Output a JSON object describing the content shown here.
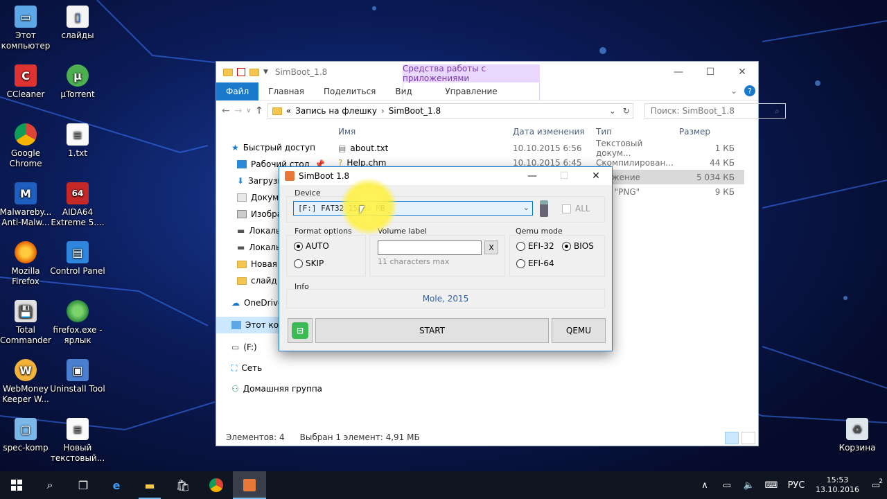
{
  "desktop": {
    "icons": [
      {
        "label": "Этот компьютер",
        "icon": "computer-icon"
      },
      {
        "label": "слайды",
        "icon": "file-icon"
      },
      {
        "label": "CCleaner",
        "icon": "ccleaner-icon"
      },
      {
        "label": "µTorrent",
        "icon": "utorrent-icon"
      },
      {
        "label": "Google Chrome",
        "icon": "chrome-icon"
      },
      {
        "label": "1.txt",
        "icon": "text-file-icon"
      },
      {
        "label": "Malwareby... Anti-Malw...",
        "icon": "malwarebytes-icon"
      },
      {
        "label": "AIDA64 Extreme 5....",
        "icon": "aida64-icon"
      },
      {
        "label": "Mozilla Firefox",
        "icon": "firefox-icon"
      },
      {
        "label": "Control Panel",
        "icon": "control-panel-icon"
      },
      {
        "label": "Total Commander",
        "icon": "total-commander-icon"
      },
      {
        "label": "firefox.exe - ярлык",
        "icon": "firefox-shortcut-icon"
      },
      {
        "label": "WebMoney Keeper W...",
        "icon": "webmoney-icon"
      },
      {
        "label": "Uninstall Tool",
        "icon": "uninstall-tool-icon"
      },
      {
        "label": "spec-komp",
        "icon": "spec-komp-icon"
      },
      {
        "label": "Новый текстовый...",
        "icon": "text-file-icon"
      },
      {
        "label": "Корзина",
        "icon": "recycle-bin-icon"
      }
    ]
  },
  "explorer": {
    "title": "SimBoot_1.8",
    "context_tab": "Средства работы с приложениями",
    "ribbon": {
      "file": "Файл",
      "home": "Главная",
      "share": "Поделиться",
      "view": "Вид",
      "manage": "Управление"
    },
    "address": {
      "prefix": "«",
      "parent": "Запись на флешку",
      "current": "SimBoot_1.8"
    },
    "search_placeholder": "Поиск: SimBoot_1.8",
    "nav": [
      {
        "label": "Быстрый доступ",
        "icon": "star-icon"
      },
      {
        "label": "Рабочий стол",
        "icon": "desktop-icon"
      },
      {
        "label": "Загрузк",
        "icon": "download-icon"
      },
      {
        "label": "Докуме",
        "icon": "documents-icon"
      },
      {
        "label": "Изобра",
        "icon": "pictures-icon"
      },
      {
        "label": "Локаль",
        "icon": "drive-icon"
      },
      {
        "label": "Локаль",
        "icon": "drive-icon"
      },
      {
        "label": "Новая",
        "icon": "folder-icon"
      },
      {
        "label": "слайд",
        "icon": "folder-icon"
      },
      {
        "label": "OneDrive",
        "icon": "onedrive-icon"
      },
      {
        "label": "Этот ком",
        "icon": "computer-icon"
      },
      {
        "label": "(F:)",
        "icon": "usb-drive-icon"
      },
      {
        "label": "Сеть",
        "icon": "network-icon"
      },
      {
        "label": "Домашняя группа",
        "icon": "homegroup-icon"
      }
    ],
    "columns": {
      "name": "Имя",
      "date": "Дата изменения",
      "type": "Тип",
      "size": "Размер"
    },
    "files": [
      {
        "name": "about.txt",
        "date": "10.10.2015 6:56",
        "type": "Текстовый докум...",
        "size": "1 КБ"
      },
      {
        "name": "Help.chm",
        "date": "10.10.2015 6:45",
        "type": "Скомпилирован...",
        "size": "44 КБ"
      },
      {
        "name": "",
        "date": "",
        "type": "иложение",
        "size": "5 034 КБ"
      },
      {
        "name": "",
        "date": "",
        "type": "айл \"PNG\"",
        "size": "9 КБ"
      }
    ],
    "status": {
      "count": "Элементов: 4",
      "selected": "Выбран 1 элемент: 4,91 МБ"
    }
  },
  "simboot": {
    "title": "SimBoot 1.8",
    "device_label": "Device",
    "device_value": "[F:]  FAT32   15266 MB",
    "all_label": "ALL",
    "format_label": "Format options",
    "format_auto": "AUTO",
    "format_skip": "SKIP",
    "volume_label": "Volume label",
    "volume_clear": "X",
    "volume_hint": "11 characters max",
    "qemu_label": "Qemu mode",
    "qemu_efi32": "EFI-32",
    "qemu_bios": "BIOS",
    "qemu_efi64": "EFI-64",
    "info_label": "Info",
    "info_text": "Mole, 2015",
    "start": "START",
    "qemu": "QEMU"
  },
  "taskbar": {
    "lang": "РУС",
    "time": "15:53",
    "date": "13.10.2016",
    "notifications": "2"
  }
}
